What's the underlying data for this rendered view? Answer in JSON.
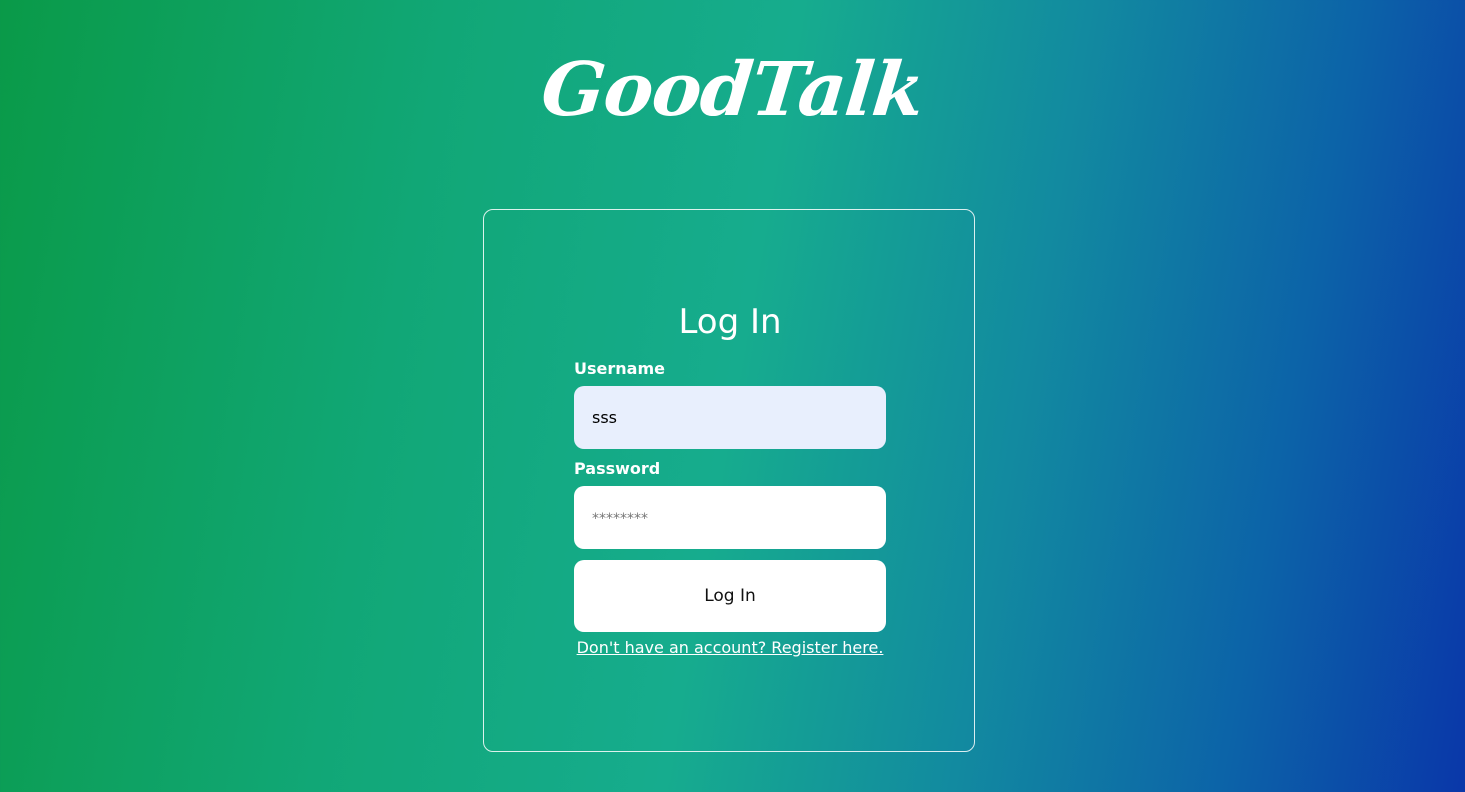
{
  "brand": {
    "logo_text": "GoodTalk"
  },
  "login": {
    "title": "Log In",
    "username_label": "Username",
    "username_value": "sss",
    "password_label": "Password",
    "password_placeholder": "********",
    "submit_label": "Log In",
    "register_link": "Don't have an account? Register here."
  },
  "colors": {
    "gradient_start": "#0a9a48",
    "gradient_mid": "#16ac8e",
    "gradient_end": "#0a37a9",
    "username_field_bg": "#e8effd"
  }
}
